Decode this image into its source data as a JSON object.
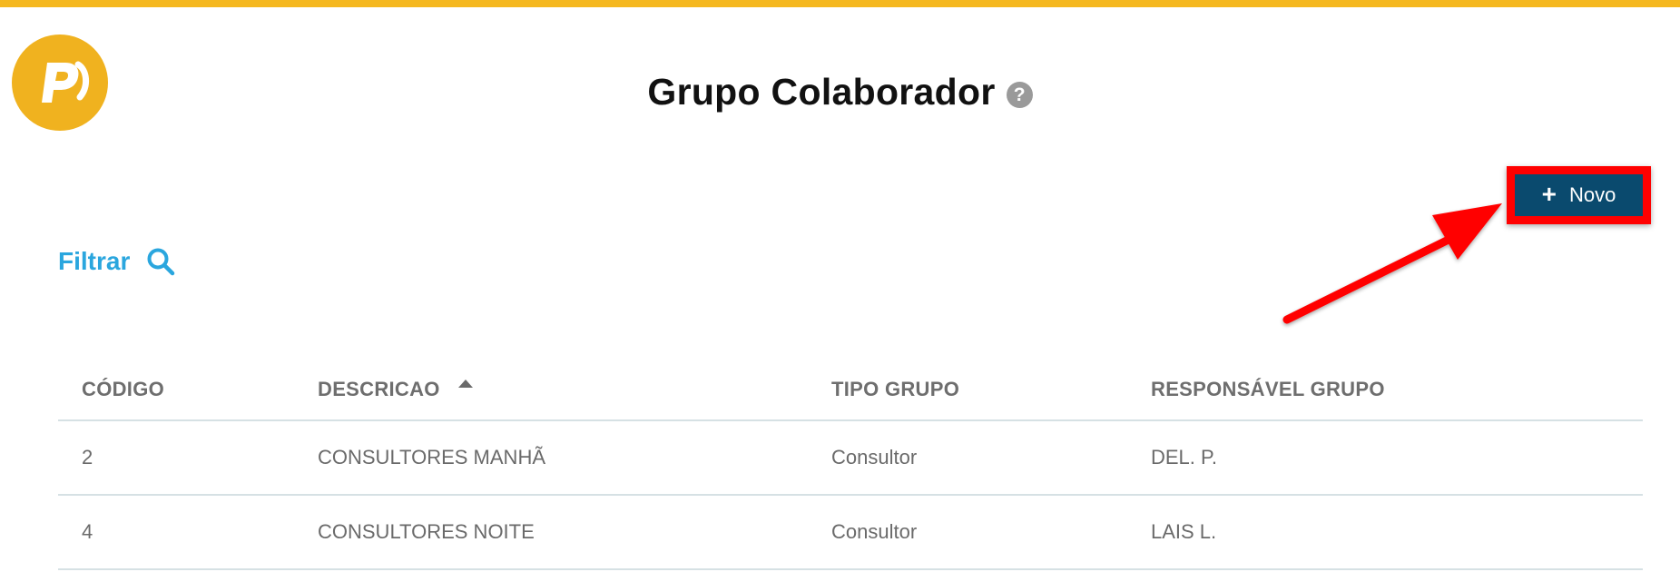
{
  "header": {
    "title": "Grupo Colaborador",
    "help_icon": "question-circle-icon"
  },
  "logo": {
    "icon": "pacto-logo",
    "color": "#f0b21f"
  },
  "toolbar": {
    "new_label": "Novo",
    "new_icon": "plus-icon",
    "button_color": "#0a4a6e",
    "highlight_color": "#ff0000"
  },
  "filter": {
    "label": "Filtrar",
    "icon": "search-icon",
    "color": "#2aa6de"
  },
  "table": {
    "columns": [
      "CÓDIGO",
      "DESCRICAO",
      "TIPO GRUPO",
      "RESPONSÁVEL GRUPO"
    ],
    "sort_column": "DESCRICAO",
    "sort_direction": "asc",
    "rows": [
      [
        "2",
        "CONSULTORES MANHÃ",
        "Consultor",
        "DEL. P."
      ],
      [
        "4",
        "CONSULTORES NOITE",
        "Consultor",
        "LAIS L."
      ]
    ]
  },
  "colors": {
    "top_bar": "#f5b820",
    "divider": "#d6e1e4"
  }
}
